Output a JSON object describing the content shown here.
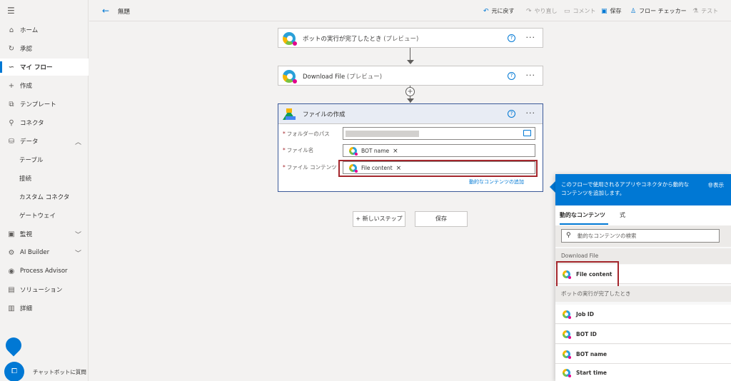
{
  "sidebar": {
    "items": [
      {
        "label": "ホーム",
        "icon": "home-icon"
      },
      {
        "label": "承認",
        "icon": "approvals-icon"
      },
      {
        "label": "マイ フロー",
        "icon": "flow-icon"
      },
      {
        "label": "作成",
        "icon": "plus-icon"
      },
      {
        "label": "テンプレート",
        "icon": "templates-icon"
      },
      {
        "label": "コネクタ",
        "icon": "connector-icon"
      },
      {
        "label": "データ",
        "icon": "data-icon"
      },
      {
        "label": "テーブル"
      },
      {
        "label": "接続"
      },
      {
        "label": "カスタム コネクタ"
      },
      {
        "label": "ゲートウェイ"
      },
      {
        "label": "監視",
        "icon": "monitor-icon"
      },
      {
        "label": "AI Builder",
        "icon": "ai-builder-icon"
      },
      {
        "label": "Process Advisor",
        "icon": "process-advisor-icon"
      },
      {
        "label": "ソリューション",
        "icon": "solutions-icon"
      },
      {
        "label": "詳細",
        "icon": "learn-icon"
      }
    ],
    "chatbot_label": "チャットボットに質問"
  },
  "topbar": {
    "title": "無題",
    "undo": "元に戻す",
    "redo": "やり直し",
    "comment": "コメント",
    "save": "保存",
    "flow_checker": "フロー チェッカー",
    "test": "テスト"
  },
  "steps": {
    "trigger": {
      "title": "ボットの実行が完了したとき",
      "preview": "(プレビュー)"
    },
    "download": {
      "title": "Download File",
      "preview": "(プレビュー)"
    },
    "create_file": {
      "title": "ファイルの作成",
      "folder_label": "フォルダーのパス",
      "filename_label": "ファイル名",
      "filename_token": "BOT name",
      "content_label": "ファイル コンテンツ",
      "content_token": "File content",
      "dynamic_link": "動的なコンテンツの追加"
    }
  },
  "actions": {
    "new_step": "+ 新しいステップ",
    "save": "保存"
  },
  "panel": {
    "description": "このフローで使用されるアプリやコネクタから動的なコンテンツを追加します。",
    "hide": "非表示",
    "tab_dynamic": "動的なコンテンツ",
    "tab_expression": "式",
    "search_placeholder": "動的なコンテンツの検索",
    "group1": "Download File",
    "group1_items": [
      "File content"
    ],
    "group2": "ボットの実行が完了したとき",
    "group2_items": [
      "Job ID",
      "BOT ID",
      "BOT name",
      "Start time"
    ]
  },
  "colors": {
    "accent": "#0078d4",
    "highlight": "#a4262c"
  }
}
